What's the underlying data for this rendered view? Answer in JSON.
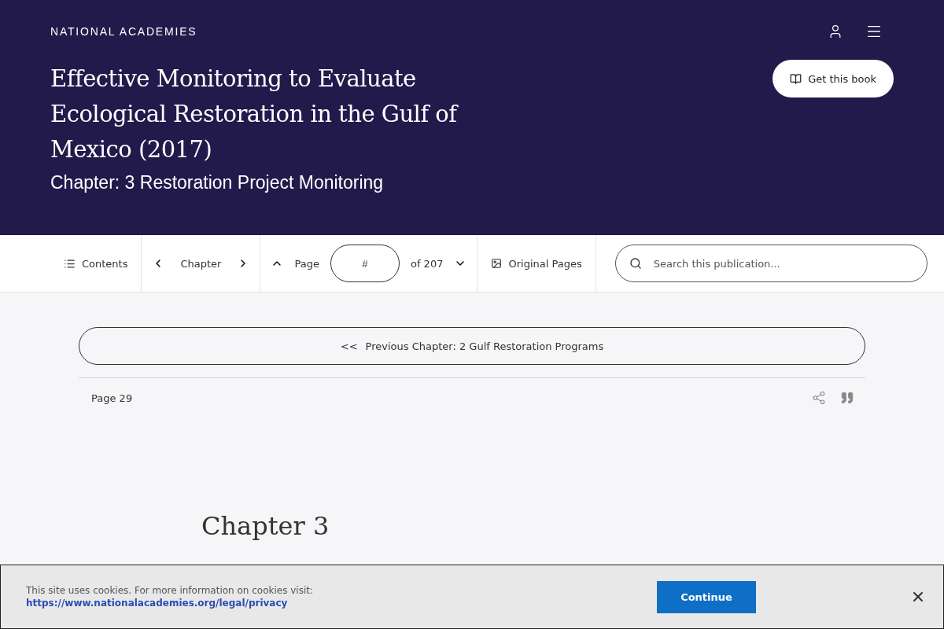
{
  "header": {
    "logo": "NATIONAL ACADEMIES",
    "title": "Effective Monitoring to Evaluate Ecological Restoration in the Gulf of Mexico (2017)",
    "chapter": "Chapter: 3 Restoration Project Monitoring",
    "get_book": "Get this book"
  },
  "toolbar": {
    "contents": "Contents",
    "chapter": "Chapter",
    "page_label": "Page",
    "page_placeholder": "#",
    "page_total": "of 207",
    "original_pages": "Original Pages",
    "search_placeholder": "Search this publication..."
  },
  "previous_chapter": {
    "arrows": "<<",
    "label": "Previous Chapter: 2 Gulf Restoration Programs"
  },
  "page_number": "Page 29",
  "chapter_heading": {
    "number": "Chapter 3"
  },
  "cookie_banner": {
    "text": "This site uses cookies. For more information on cookies visit:",
    "link": "https://www.nationalacademies.org/legal/privacy",
    "button": "Continue"
  }
}
